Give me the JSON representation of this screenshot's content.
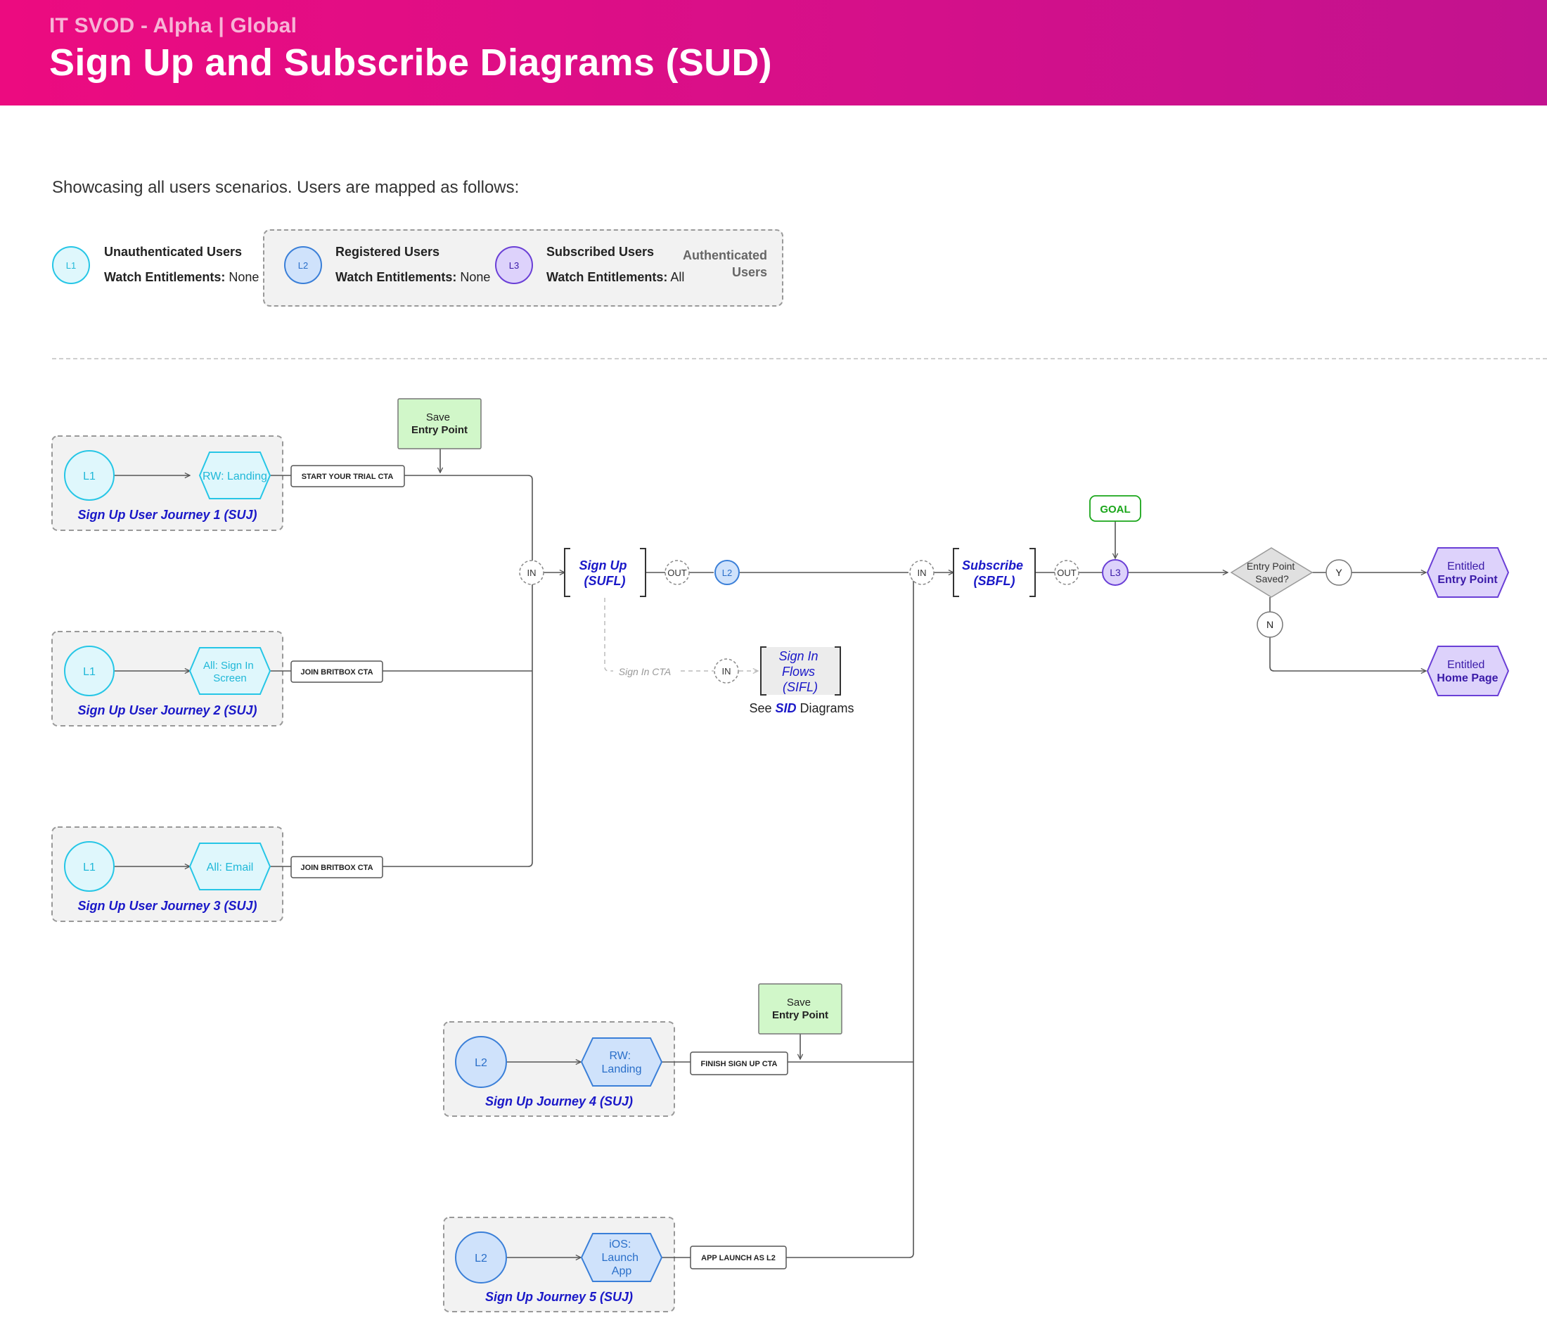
{
  "header": {
    "subtitle": "IT SVOD - Alpha | Global",
    "title": "Sign Up and Subscribe Diagrams (SUD)"
  },
  "intro": "Showcasing all users scenarios. Users are mapped as follows:",
  "legend": {
    "l1": {
      "badge": "L1",
      "title": "Unauthenticated Users",
      "ent_label": "Watch Entitlements:",
      "ent_value": "None"
    },
    "l2": {
      "badge": "L2",
      "title": "Registered Users",
      "ent_label": "Watch Entitlements:",
      "ent_value": "None"
    },
    "l3": {
      "badge": "L3",
      "title": "Subscribed Users",
      "ent_label": "Watch Entitlements:",
      "ent_value": "All"
    },
    "auth_line1": "Authenticated",
    "auth_line2": "Users"
  },
  "journeys": {
    "j1": {
      "badge": "L1",
      "screen": [
        "RW: Landing"
      ],
      "label": "Sign Up User Journey 1 (SUJ)",
      "cta": "START YOUR TRIAL CTA"
    },
    "j2": {
      "badge": "L1",
      "screen": [
        "All: Sign In",
        "Screen"
      ],
      "label": "Sign Up User Journey 2 (SUJ)",
      "cta": "JOIN BRITBOX CTA"
    },
    "j3": {
      "badge": "L1",
      "screen": [
        "All: Email"
      ],
      "label": "Sign Up User Journey 3 (SUJ)",
      "cta": "JOIN BRITBOX CTA"
    },
    "j4": {
      "badge": "L2",
      "screen": [
        "RW:",
        "Landing"
      ],
      "label": "Sign Up Journey 4 (SUJ)",
      "cta": "FINISH SIGN UP CTA"
    },
    "j5": {
      "badge": "L2",
      "screen": [
        "iOS:",
        "Launch",
        "App"
      ],
      "label": "Sign Up Journey 5 (SUJ)",
      "cta": "APP LAUNCH AS L2"
    }
  },
  "save_entry": {
    "line1": "Save",
    "line2": "Entry Point"
  },
  "flows": {
    "in_label": "IN",
    "out_label": "OUT",
    "signup": [
      "Sign Up",
      "(SUFL)"
    ],
    "subscribe": [
      "Subscribe",
      "(SBFL)"
    ],
    "signin": [
      "Sign In",
      "Flows",
      "(SIFL)"
    ],
    "signin_cta": "Sign In CTA",
    "see_prefix": "See ",
    "see_em": "SID",
    "see_suffix": " Diagrams",
    "l2_badge": "L2",
    "l3_badge": "L3",
    "goal": "GOAL",
    "decision": [
      "Entry Point",
      "Saved?"
    ],
    "yes": "Y",
    "no": "N"
  },
  "outcomes": {
    "entry": {
      "line1": "Entitled",
      "line2": "Entry Point"
    },
    "home": {
      "line1": "Entitled",
      "line2": "Home Page"
    }
  },
  "colors": {
    "header_start": "#ec0b80",
    "header_end": "#c2128f",
    "l1_fill": "#dff7fc",
    "l1_stroke": "#26c6e6",
    "l1_text": "#1fb8d8",
    "l2_fill": "#cfe2fb",
    "l2_stroke": "#3a7fd8",
    "l2_text": "#2a6fc9",
    "l3_fill": "#ddd2fb",
    "l3_stroke": "#6a3fd6",
    "l3_text": "#3a1aa8",
    "journey_label": "#1a18c8",
    "goal": "#1aa61a",
    "save_fill": "#d1f7c9"
  }
}
